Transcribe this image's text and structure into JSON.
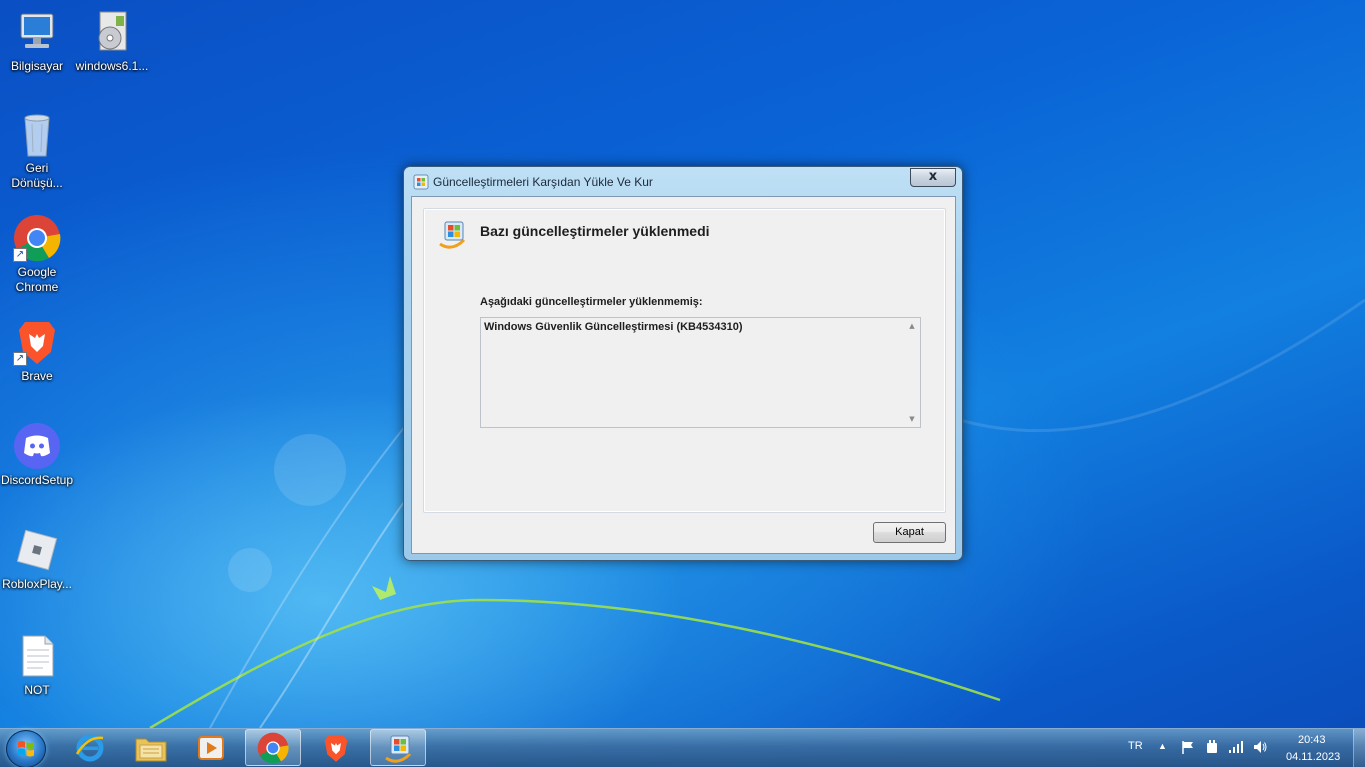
{
  "desktop": {
    "icons": [
      {
        "label": "Bilgisayar",
        "icon": "computer-icon"
      },
      {
        "label": "windows6.1...",
        "icon": "installer-icon"
      },
      {
        "label": "Geri Dönüşü...",
        "icon": "recycle-bin-icon"
      },
      {
        "label": "Google Chrome",
        "icon": "chrome-icon"
      },
      {
        "label": "Brave",
        "icon": "brave-icon"
      },
      {
        "label": "DiscordSetup",
        "icon": "discord-icon"
      },
      {
        "label": "RobloxPlay...",
        "icon": "roblox-icon"
      },
      {
        "label": "NOT",
        "icon": "text-file-icon"
      }
    ]
  },
  "dialog": {
    "title": "Güncelleştirmeleri Karşıdan Yükle Ve Kur",
    "close_label": "x",
    "heading": "Bazı güncelleştirmeler yüklenmedi",
    "sublabel": "Aşağıdaki güncelleştirmeler yüklenmemiş:",
    "items": [
      "Windows Güvenlik Güncelleştirmesi (KB4534310)"
    ],
    "button_label": "Kapat"
  },
  "taskbar": {
    "pinned": [
      "internet-explorer-icon",
      "file-explorer-icon",
      "media-player-icon",
      "chrome-icon",
      "brave-icon",
      "windows-update-icon"
    ],
    "language": "TR",
    "time": "20:43",
    "date": "04.11.2023"
  },
  "colors": {
    "desktop_blue": "#0a64d6",
    "dialog_frame": "#a8d2ef",
    "taskbar": "#3c6ea0"
  }
}
